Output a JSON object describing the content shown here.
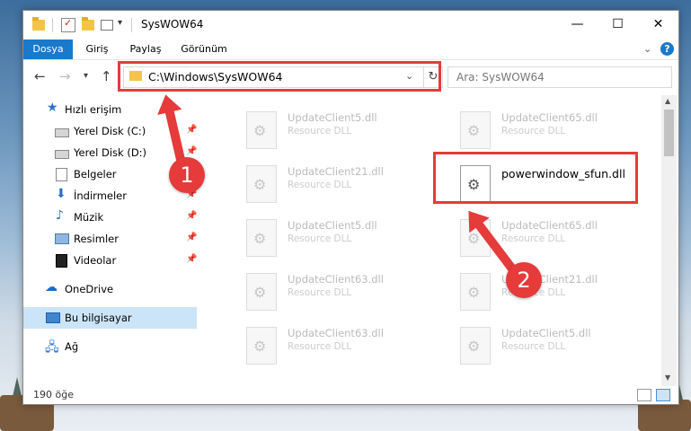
{
  "window": {
    "title": "SysWOW64"
  },
  "ribbon": {
    "tabs": [
      "Dosya",
      "Giriş",
      "Paylaş",
      "Görünüm"
    ],
    "help": "?"
  },
  "nav": {
    "address": "C:\\Windows\\SysWOW64",
    "search_placeholder": "Ara: SysWOW64"
  },
  "sidebar": {
    "items": [
      {
        "label": "Hızlı erişim",
        "icon": "star-icon"
      },
      {
        "label": "Yerel Disk (C:)",
        "icon": "disk-icon",
        "pinned": true
      },
      {
        "label": "Yerel Disk (D:)",
        "icon": "disk-icon",
        "pinned": true
      },
      {
        "label": "Belgeler",
        "icon": "documents-icon",
        "pinned": true
      },
      {
        "label": "İndirmeler",
        "icon": "download-icon",
        "pinned": true
      },
      {
        "label": "Müzik",
        "icon": "music-icon",
        "pinned": true
      },
      {
        "label": "Resimler",
        "icon": "pictures-icon",
        "pinned": true
      },
      {
        "label": "Videolar",
        "icon": "videos-icon",
        "pinned": true
      },
      {
        "label": "OneDrive",
        "icon": "cloud-icon"
      },
      {
        "label": "Bu bilgisayar",
        "icon": "computer-icon",
        "selected": true
      },
      {
        "label": "Ağ",
        "icon": "network-icon"
      }
    ]
  },
  "files": [
    {
      "name": "UpdateClient5.dll",
      "type": "Resource DLL"
    },
    {
      "name": "UpdateClient65.dll",
      "type": "Resource DLL"
    },
    {
      "name": "UpdateClient21.dll",
      "type": "Resource DLL"
    },
    {
      "name": "powerwindow_sfun.dll",
      "type": "",
      "highlighted": true
    },
    {
      "name": "UpdateClient5.dll",
      "type": "Resource DLL"
    },
    {
      "name": "UpdateClient65.dll",
      "type": "Resource DLL"
    },
    {
      "name": "UpdateClient63.dll",
      "type": "Resource DLL"
    },
    {
      "name": "UpdateClient21.dll",
      "type": "Resource DLL"
    },
    {
      "name": "UpdateClient63.dll",
      "type": "Resource DLL"
    },
    {
      "name": "UpdateClient5.dll",
      "type": "Resource DLL"
    }
  ],
  "status": {
    "count": "190 öğe"
  },
  "annotations": {
    "badge1": "1",
    "badge2": "2",
    "color": "#e53b3b"
  }
}
